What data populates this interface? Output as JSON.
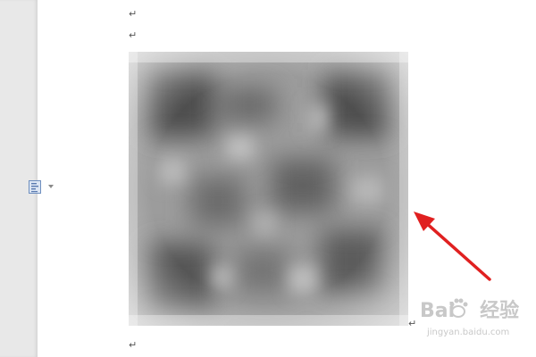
{
  "document": {
    "paragraph_mark": "↵"
  },
  "image_layout_options": {
    "icon": "layout-options-icon",
    "dropdown_icon": "chevron-down-icon"
  },
  "image": {
    "content": "blurred QR code"
  },
  "annotation": {
    "arrow_color": "#e02020"
  },
  "watermark": {
    "logo_text": "Bai",
    "logo_text_2": "经验",
    "url": "jingyan.baidu.com"
  }
}
